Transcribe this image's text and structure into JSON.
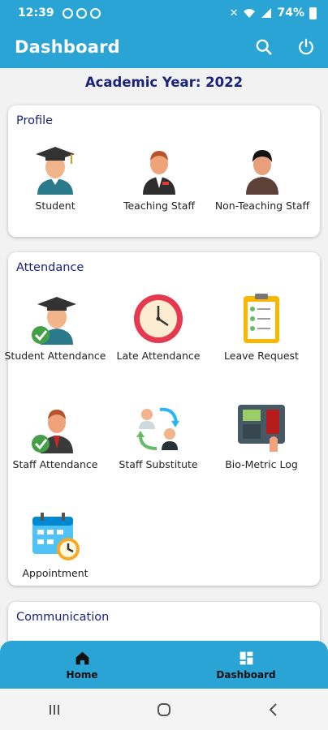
{
  "status": {
    "time": "12:39",
    "battery": "74%"
  },
  "appbar": {
    "title": "Dashboard",
    "search_icon": "search-icon",
    "power_icon": "power-icon"
  },
  "academic_year": "Academic Year: 2022",
  "profile": {
    "title": "Profile",
    "items": [
      {
        "label": "Student",
        "icon": "student-graduate-icon"
      },
      {
        "label": "Teaching Staff",
        "icon": "teacher-icon"
      },
      {
        "label": "Non-Teaching Staff",
        "icon": "staff-person-icon"
      }
    ]
  },
  "attendance": {
    "title": "Attendance",
    "items": [
      {
        "label": "Student Attendance",
        "icon": "student-check-icon"
      },
      {
        "label": "Late Attendance",
        "icon": "clock-icon"
      },
      {
        "label": "Leave Request",
        "icon": "checklist-clipboard-icon"
      },
      {
        "label": "Staff Attendance",
        "icon": "staff-check-icon"
      },
      {
        "label": "Staff Substitute",
        "icon": "substitute-swap-icon"
      },
      {
        "label": "Bio-Metric Log",
        "icon": "fingerprint-device-icon"
      },
      {
        "label": "Appointment",
        "icon": "calendar-clock-icon"
      }
    ]
  },
  "communication": {
    "title": "Communication"
  },
  "bottom_nav": {
    "home": "Home",
    "dashboard": "Dashboard"
  },
  "colors": {
    "primary": "#2aa4d4",
    "heading": "#1a237e"
  }
}
